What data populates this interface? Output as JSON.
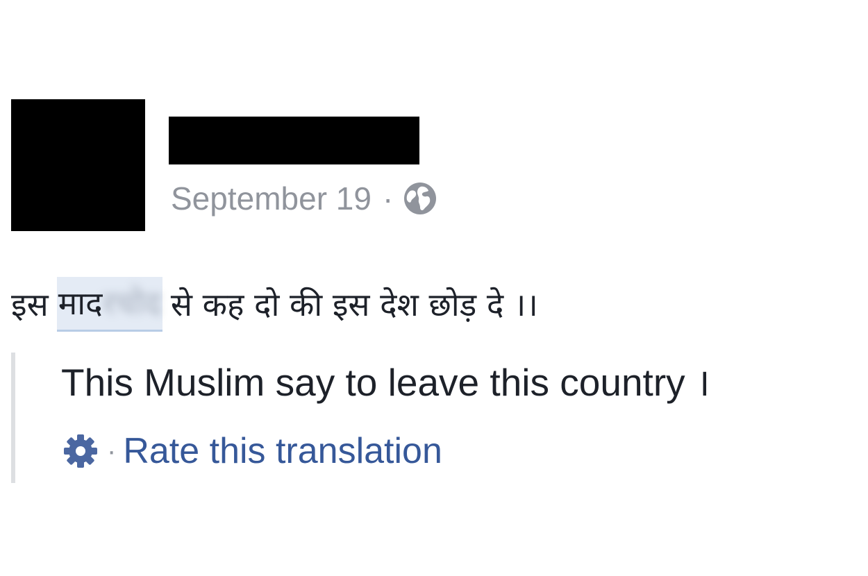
{
  "post": {
    "date": "September 19",
    "separator": "·",
    "visibility_icon": "globe-icon",
    "text_before": "इस",
    "text_highlight_visible": "माद",
    "text_highlight_obscured": "रचोद",
    "text_after": "से कह दो की इस देश छोड़ दे ।।"
  },
  "translation": {
    "text": "This Muslim say to leave this country ।",
    "settings_icon": "gear-icon",
    "separator": "·",
    "rate_link": "Rate this translation"
  },
  "colors": {
    "meta_gray": "#90949c",
    "link_blue": "#365899",
    "text_dark": "#1d2129",
    "highlight_bg": "#e4ebf5",
    "quote_border": "#dddfe2",
    "redaction": "#000000"
  }
}
